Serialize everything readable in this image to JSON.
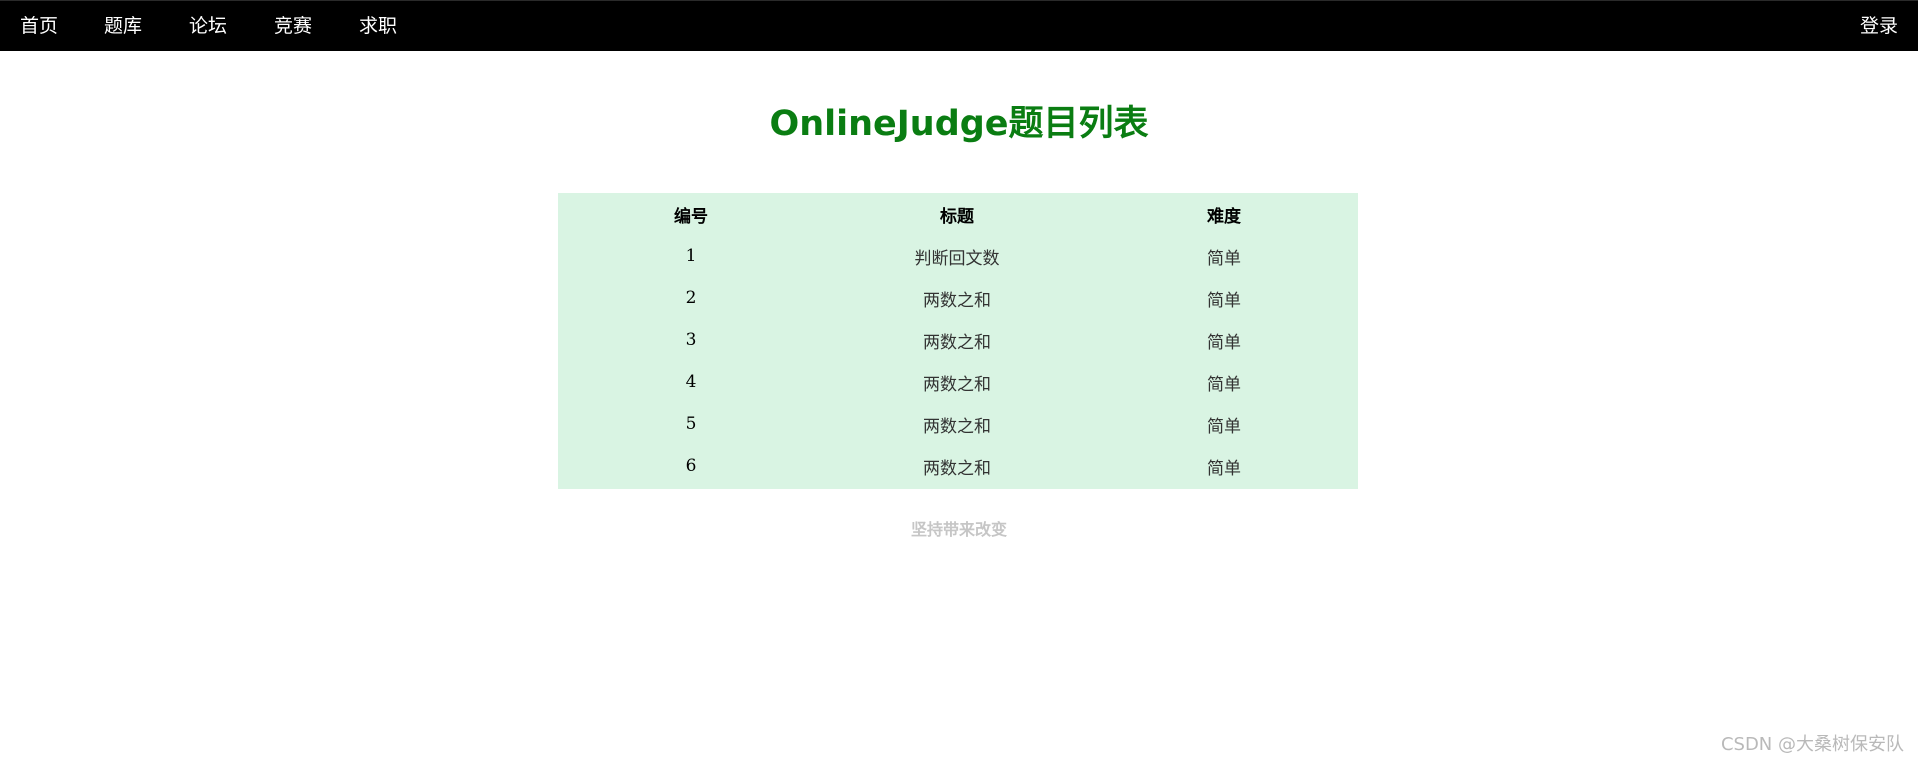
{
  "nav": {
    "items": [
      {
        "label": "首页"
      },
      {
        "label": "题库"
      },
      {
        "label": "论坛"
      },
      {
        "label": "竞赛"
      },
      {
        "label": "求职"
      }
    ],
    "login": "登录"
  },
  "page": {
    "title": "OnlineJudge题目列表"
  },
  "problem_table": {
    "headers": [
      "编号",
      "标题",
      "难度"
    ],
    "rows": [
      {
        "id": "1",
        "title": "判断回文数",
        "difficulty": "简单"
      },
      {
        "id": "2",
        "title": "两数之和",
        "difficulty": "简单"
      },
      {
        "id": "3",
        "title": "两数之和",
        "difficulty": "简单"
      },
      {
        "id": "4",
        "title": "两数之和",
        "difficulty": "简单"
      },
      {
        "id": "5",
        "title": "两数之和",
        "difficulty": "简单"
      },
      {
        "id": "6",
        "title": "两数之和",
        "difficulty": "简单"
      }
    ]
  },
  "footer": {
    "slogan": "坚持带来改变"
  },
  "watermark": "CSDN @大桑树保安队",
  "colors": {
    "topbar": "#000000",
    "title": "#0a7d12",
    "table_bg": "#d9f4e3",
    "slogan": "#c6c6c6"
  }
}
